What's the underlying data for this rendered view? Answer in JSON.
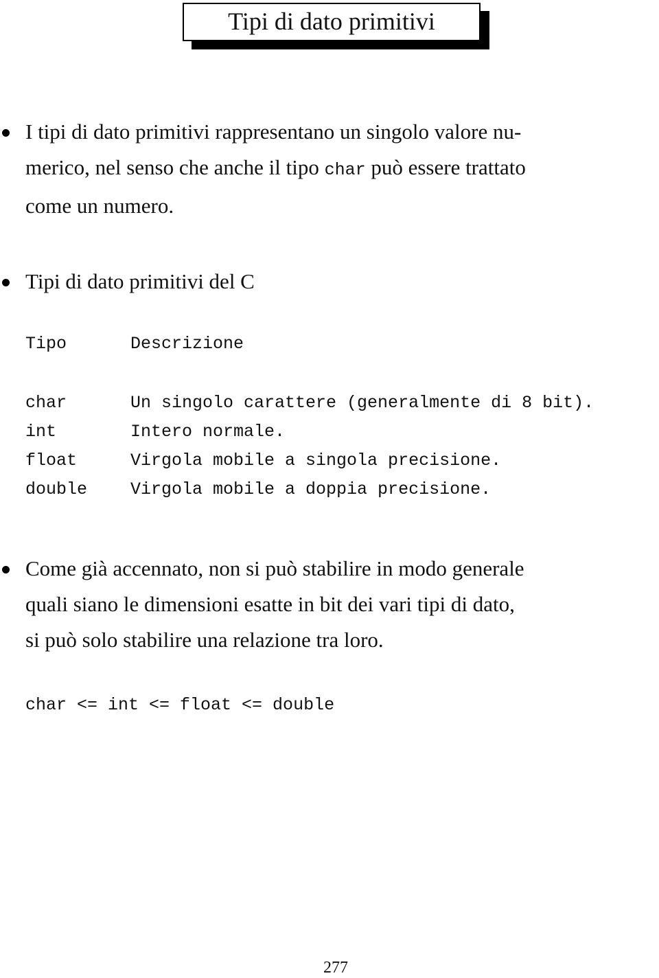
{
  "page": {
    "title": "Tipi di dato primitivi",
    "page_number": "277"
  },
  "bullets": [
    {
      "lines": [
        [
          "I tipi di dato primitivi rappresentano un singolo valore nu-"
        ],
        [
          "merico, nel senso che anche il tipo ",
          "char",
          " può essere trattato"
        ],
        [
          "come un numero."
        ]
      ],
      "code_word": "char"
    },
    {
      "text": "Tipi di dato primitivi del C"
    },
    {
      "lines": [
        "Come già accennato, non si può stabilire in modo generale",
        "quali siano le dimensioni esatte in bit dei vari tipi di dato,",
        "si può solo stabilire una relazione tra loro."
      ]
    }
  ],
  "type_table": {
    "headers": [
      "Tipo",
      "Descrizione"
    ],
    "rows": [
      {
        "type": "char",
        "description": "Un singolo carattere (generalmente di 8 bit)."
      },
      {
        "type": "int",
        "description": "Intero normale."
      },
      {
        "type": "float",
        "description": "Virgola mobile a singola precisione."
      },
      {
        "type": "double",
        "description": "Virgola mobile a doppia precisione."
      }
    ]
  },
  "relation": "char <= int <= float <= double"
}
